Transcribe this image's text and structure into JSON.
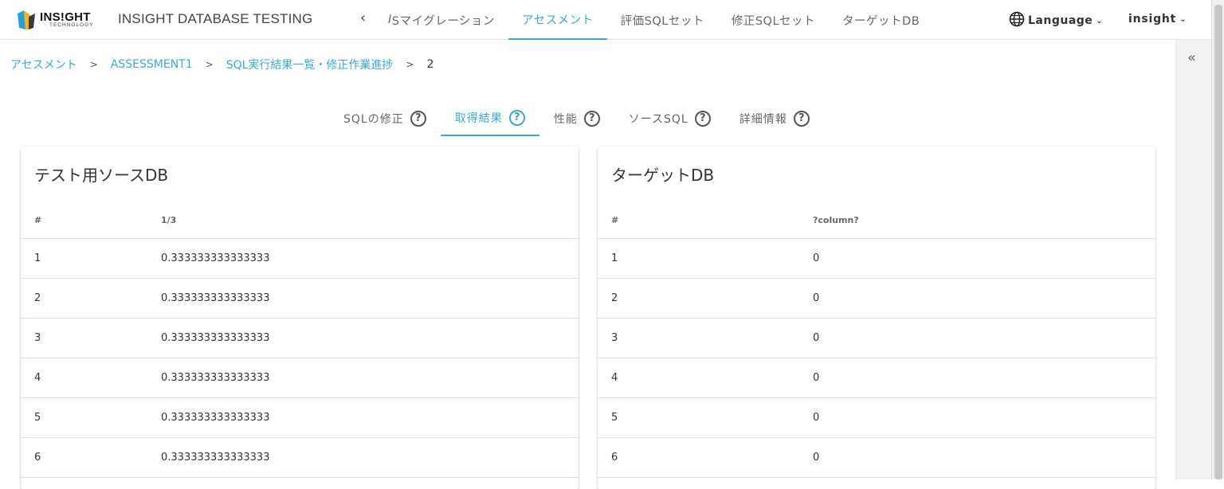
{
  "header": {
    "logo_main": "INS!GHT",
    "logo_sub": "TECHNOLOGY",
    "app_title": "INSIGHT DATABASE TESTING",
    "nav_back": "‹",
    "nav_items": [
      {
        "label_prefix": "I",
        "label": "Sマイグレーション"
      },
      {
        "label": "アセスメント"
      },
      {
        "label": "評価SQLセット"
      },
      {
        "label": "修正SQLセット"
      },
      {
        "label": "ターゲットDB"
      }
    ],
    "language_label": "Language",
    "user_label": "insight",
    "accent_color": "#3fa9c9"
  },
  "breadcrumb": {
    "items": [
      "アセスメント",
      "ASSESSMENT1",
      "SQL実行結果一覧・修正作業進捗",
      "2"
    ]
  },
  "tabs": [
    {
      "label": "SQLの修正"
    },
    {
      "label": "取得結果"
    },
    {
      "label": "性能"
    },
    {
      "label": "ソースSQL"
    },
    {
      "label": "詳細情報"
    }
  ],
  "source_panel": {
    "title": "テスト用ソースDB",
    "columns": [
      "#",
      "1/3"
    ],
    "rows": [
      [
        "1",
        "0.333333333333333"
      ],
      [
        "2",
        "0.333333333333333"
      ],
      [
        "3",
        "0.333333333333333"
      ],
      [
        "4",
        "0.333333333333333"
      ],
      [
        "5",
        "0.333333333333333"
      ],
      [
        "6",
        "0.333333333333333"
      ]
    ]
  },
  "target_panel": {
    "title": "ターゲットDB",
    "columns": [
      "#",
      "?column?"
    ],
    "rows": [
      [
        "1",
        "0"
      ],
      [
        "2",
        "0"
      ],
      [
        "3",
        "0"
      ],
      [
        "4",
        "0"
      ],
      [
        "5",
        "0"
      ],
      [
        "6",
        "0"
      ]
    ]
  },
  "icons": {
    "help": "?",
    "collapse": "«",
    "chevron": "⌄"
  }
}
